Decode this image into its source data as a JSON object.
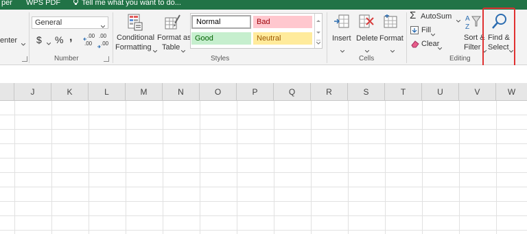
{
  "title_bar": {
    "tab_partial": "per",
    "wps_pdf": "WPS PDF",
    "tell_me": "Tell me what you want to do..."
  },
  "alignment": {
    "merge_partial": "enter"
  },
  "number": {
    "format_value": "General",
    "currency": "$",
    "percent": "%",
    "comma": ",",
    "inc_decimal": ".00",
    "dec_decimal": ".00",
    "group_label": "Number"
  },
  "styles": {
    "conditional_line1": "Conditional",
    "conditional_line2": "Formatting",
    "format_table_line1": "Format as",
    "format_table_line2": "Table",
    "normal": "Normal",
    "bad": "Bad",
    "good": "Good",
    "neutral": "Neutral",
    "group_label": "Styles",
    "colors": {
      "bad_bg": "#ffc7ce",
      "bad_fg": "#9c0006",
      "good_bg": "#c6efce",
      "good_fg": "#006100",
      "neutral_bg": "#ffeb9c",
      "neutral_fg": "#9c5700"
    }
  },
  "cells": {
    "insert": "Insert",
    "delete": "Delete",
    "format": "Format",
    "group_label": "Cells"
  },
  "editing": {
    "autosum": "AutoSum",
    "fill": "Fill",
    "clear": "Clear",
    "sort_line1": "Sort &",
    "sort_line2": "Filter",
    "find_line1": "Find &",
    "find_line2": "Select",
    "group_label": "Editing"
  },
  "columns": [
    "J",
    "K",
    "L",
    "M",
    "N",
    "O",
    "P",
    "Q",
    "R",
    "S",
    "T",
    "U",
    "V",
    "W"
  ],
  "theme": {
    "excel_green": "#217346",
    "highlight_red": "#e03030"
  }
}
